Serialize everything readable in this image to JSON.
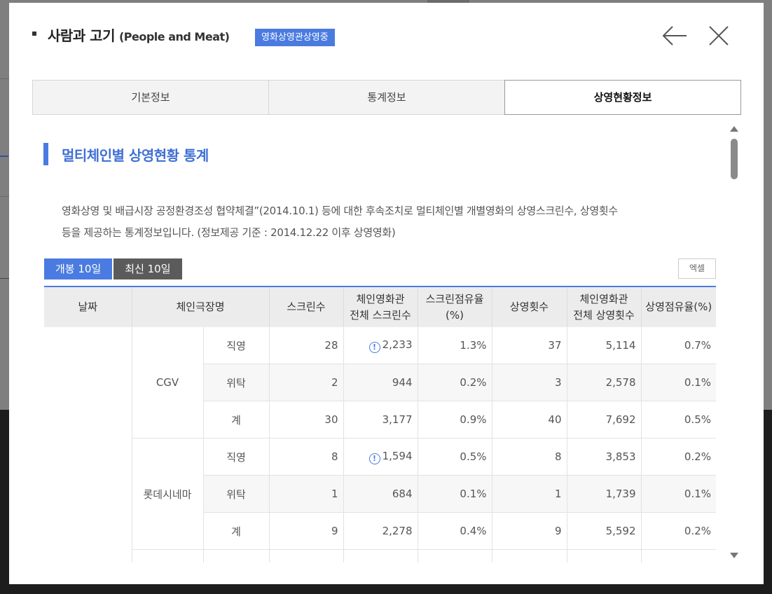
{
  "modal": {
    "title": "사람과 고기",
    "title_en": "(People and Meat)",
    "badge": "영화상영관상영중",
    "back_icon": "arrow-left-icon",
    "close_icon": "close-icon"
  },
  "tabs": [
    "기본정보",
    "통계정보",
    "상영현황정보"
  ],
  "active_tab": "상영현황정보",
  "section": {
    "title": "멀티체인별 상영현황 통계",
    "desc_line1": "영화상영 및 배급시장 공정환경조성 협약체결”(2014.10.1) 등에 대한 후속조치로 멀티체인별 개별영화의 상영스크린수, 상영횟수",
    "desc_line2": "등을 제공하는 통계정보입니다. (정보제공 기준 : 2014.12.22 이후 상영영화)"
  },
  "subtabs": {
    "opening": "개봉 10일",
    "recent": "최신 10일"
  },
  "excel_label": "엑셀",
  "table": {
    "headers": {
      "date": "날짜",
      "chain": "체인극장명",
      "screens": "스크린수",
      "chain_total_screens_1": "체인영화관",
      "chain_total_screens_2": "전체 스크린수",
      "screen_share_1": "스크린점유율",
      "screen_share_2": "(%)",
      "shows": "상영횟수",
      "chain_total_shows_1": "체인영화관",
      "chain_total_shows_2": "전체 상영횟수",
      "show_share": "상영점유율(%)"
    },
    "groups": [
      {
        "chain": "CGV",
        "rows": [
          {
            "type": "직영",
            "screens": "28",
            "total_screens": "2,233",
            "info": true,
            "screen_share": "1.3%",
            "shows": "37",
            "total_shows": "5,114",
            "show_share": "0.7%"
          },
          {
            "type": "위탁",
            "screens": "2",
            "total_screens": "944",
            "info": false,
            "screen_share": "0.2%",
            "shows": "3",
            "total_shows": "2,578",
            "show_share": "0.1%"
          },
          {
            "type": "계",
            "screens": "30",
            "total_screens": "3,177",
            "info": false,
            "screen_share": "0.9%",
            "shows": "40",
            "total_shows": "7,692",
            "show_share": "0.5%"
          }
        ]
      },
      {
        "chain": "롯데시네마",
        "rows": [
          {
            "type": "직영",
            "screens": "8",
            "total_screens": "1,594",
            "info": true,
            "screen_share": "0.5%",
            "shows": "8",
            "total_shows": "3,853",
            "show_share": "0.2%"
          },
          {
            "type": "위탁",
            "screens": "1",
            "total_screens": "684",
            "info": false,
            "screen_share": "0.1%",
            "shows": "1",
            "total_shows": "1,739",
            "show_share": "0.1%"
          },
          {
            "type": "계",
            "screens": "9",
            "total_screens": "2,278",
            "info": false,
            "screen_share": "0.4%",
            "shows": "9",
            "total_shows": "5,592",
            "show_share": "0.2%"
          }
        ]
      }
    ]
  },
  "colors": {
    "accent": "#4a7be0",
    "dark_tab": "#5b5b5b",
    "header_bg": "#ececec",
    "row_alt": "#f7f7f7"
  }
}
